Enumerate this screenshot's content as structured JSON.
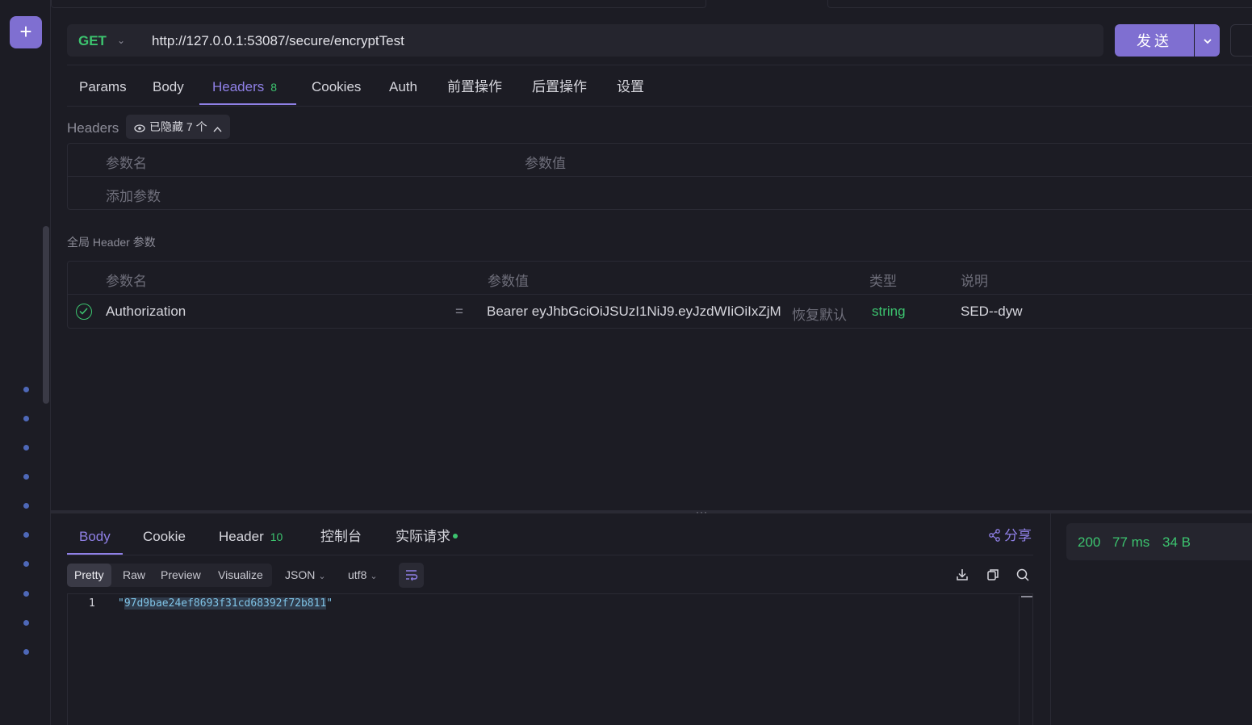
{
  "sidebar": {
    "add_label": "+"
  },
  "request": {
    "method": "GET",
    "url": "http://127.0.0.1:53087/secure/encryptTest",
    "send_label": "发送"
  },
  "request_tabs": [
    {
      "label": "Params"
    },
    {
      "label": "Body"
    },
    {
      "label": "Headers",
      "count": "8"
    },
    {
      "label": "Cookies"
    },
    {
      "label": "Auth"
    },
    {
      "label": "前置操作"
    },
    {
      "label": "后置操作"
    },
    {
      "label": "设置"
    }
  ],
  "headers": {
    "title": "Headers",
    "hidden_chip": "已隐藏 7 个",
    "columns": [
      "参数名",
      "参数值"
    ],
    "add_param": "添加参数"
  },
  "global_headers": {
    "title": "全局 Header 参数",
    "columns": [
      "参数名",
      "参数值",
      "类型",
      "说明"
    ],
    "rows": [
      {
        "name": "Authorization",
        "operator": "=",
        "value": "Bearer eyJhbGciOiJSUzI1NiJ9.eyJzdWIiOiIxZjM",
        "restore": "恢复默认",
        "type": "string",
        "description": "SED--dyw"
      }
    ]
  },
  "response_tabs": [
    {
      "label": "Body"
    },
    {
      "label": "Cookie"
    },
    {
      "label": "Header",
      "count": "10"
    },
    {
      "label": "控制台"
    },
    {
      "label": "实际请求"
    }
  ],
  "share_label": "分享",
  "format": {
    "modes": [
      "Pretty",
      "Raw",
      "Preview",
      "Visualize"
    ],
    "type": "JSON",
    "encoding": "utf8"
  },
  "body": {
    "line_number": "1",
    "quote": "\"",
    "value": "97d9bae24ef8693f31cd68392f72b811"
  },
  "status": {
    "code": "200",
    "time": "77 ms",
    "size": "34 B"
  },
  "colors": {
    "accent": "#7f6fd1",
    "success": "#3cc46f",
    "background": "#1c1c24"
  }
}
